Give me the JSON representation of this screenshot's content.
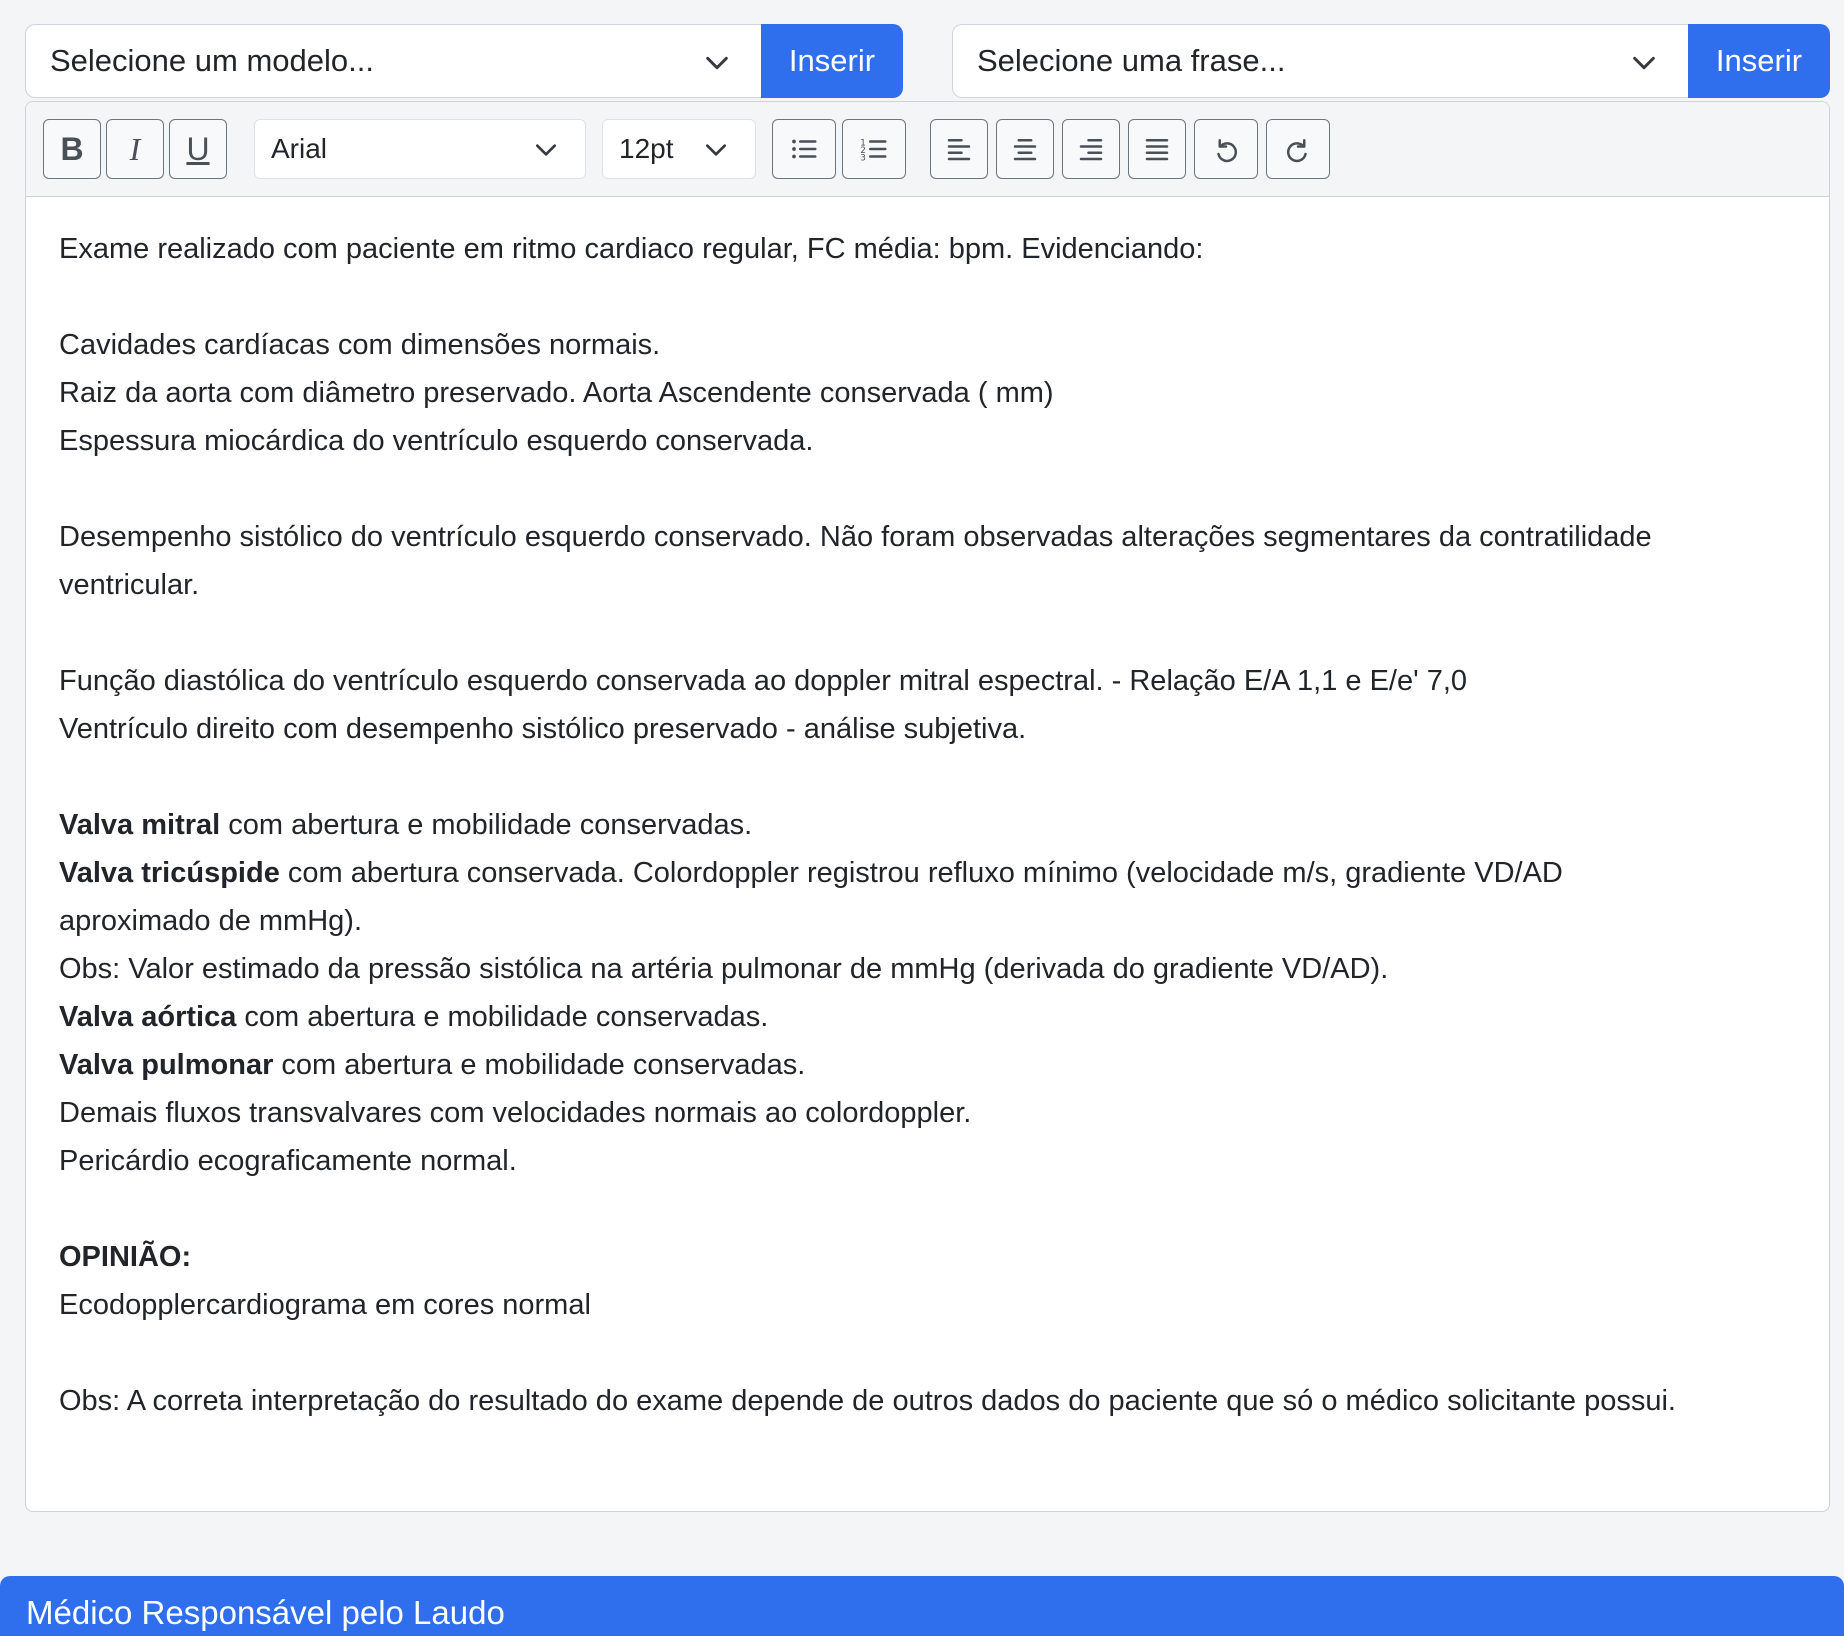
{
  "model_picker": {
    "placeholder": "Selecione um modelo...",
    "insert_label": "Inserir"
  },
  "phrase_picker": {
    "placeholder": "Selecione uma frase...",
    "insert_label": "Inserir"
  },
  "toolbar": {
    "bold_label": "B",
    "italic_label": "I",
    "underline_label": "U",
    "font_family": "Arial",
    "font_size": "12pt"
  },
  "report": {
    "p1": "Exame realizado com paciente em ritmo cardiaco regular, FC média: bpm. Evidenciando:",
    "p2": "Cavidades cardíacas com dimensões normais.",
    "p3": "Raiz da aorta com diâmetro preservado. Aorta Ascendente conservada ( mm)",
    "p4": "Espessura miocárdica do ventrículo esquerdo conservada.",
    "p5": "Desempenho sistólico do ventrículo esquerdo conservado. Não foram observadas alterações segmentares da contratilidade ventricular.",
    "p6": "Função diastólica do ventrículo esquerdo conservada ao doppler mitral espectral. - Relação E/A 1,1 e E/e' 7,0",
    "p7": "Ventrículo direito com desempenho sistólico preservado - análise subjetiva.",
    "mitral_bold": "Valva mitral",
    "mitral_rest": " com abertura e mobilidade conservadas.",
    "tricuspid_bold": "Valva tricúspide",
    "tricuspid_rest": " com abertura conservada. Colordoppler registrou refluxo mínimo (velocidade m/s, gradiente VD/AD aproximado de mmHg).",
    "obs_pressure": "Obs: Valor estimado da pressão sistólica na artéria pulmonar de mmHg (derivada do gradiente VD/AD).",
    "aortic_bold": "Valva aórtica",
    "aortic_rest": " com abertura e mobilidade conservadas.",
    "pulmonary_bold": "Valva pulmonar",
    "pulmonary_rest": " com abertura e mobilidade conservadas.",
    "flows": "Demais fluxos transvalvares com velocidades normais ao colordoppler.",
    "pericardium": "Pericárdio ecograficamente normal.",
    "opinion_heading": "OPINIÃO:",
    "opinion_text": "Ecodopplercardiograma em cores normal",
    "final_obs": "Obs: A correta interpretação do resultado do exame depende de outros dados do paciente que só o médico solicitante possui."
  },
  "footer": {
    "title": "Médico Responsável pelo Laudo"
  },
  "colors": {
    "primary": "#2f6fee",
    "border": "#cfd3d8",
    "text": "#212529"
  }
}
